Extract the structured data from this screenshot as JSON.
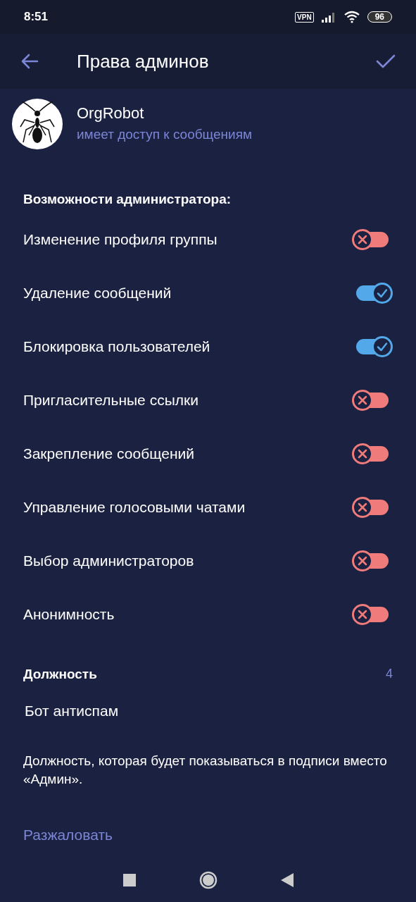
{
  "status_bar": {
    "time": "8:51",
    "vpn": "VPN",
    "battery": "96"
  },
  "header": {
    "title": "Права админов"
  },
  "profile": {
    "name": "OrgRobot",
    "status": "имеет доступ к сообщениям"
  },
  "permissions": {
    "heading": "Возможности администратора:",
    "items": [
      {
        "label": "Изменение профиля группы",
        "on": false
      },
      {
        "label": "Удаление сообщений",
        "on": true
      },
      {
        "label": "Блокировка пользователей",
        "on": true
      },
      {
        "label": "Пригласительные ссылки",
        "on": false
      },
      {
        "label": "Закрепление сообщений",
        "on": false
      },
      {
        "label": "Управление голосовыми чатами",
        "on": false
      },
      {
        "label": "Выбор администраторов",
        "on": false
      },
      {
        "label": "Анонимность",
        "on": false
      }
    ]
  },
  "rank": {
    "heading": "Должность",
    "counter": "4",
    "value": "Бот антиспам",
    "hint": "Должность, которая будет показываться в подписи вместо «Админ»."
  },
  "dismiss": {
    "label": "Разжаловать"
  }
}
